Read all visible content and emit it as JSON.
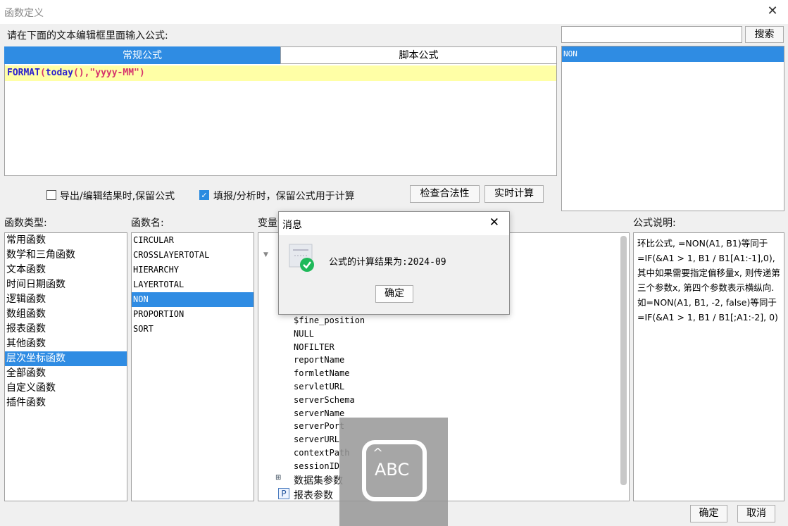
{
  "window": {
    "title": "函数定义"
  },
  "editor_prompt": "请在下面的文本编辑框里面输入公式:",
  "search": {
    "value": "",
    "button_label": "搜索"
  },
  "tabs": [
    {
      "label": "常规公式",
      "active": true
    },
    {
      "label": "脚本公式",
      "active": false
    }
  ],
  "formula": {
    "fn": "FORMAT",
    "p1": "(",
    "arg1": "today",
    "p2": "(),",
    "arg2": "\"yyyy-MM\"",
    "p3": ")"
  },
  "search_results": [
    {
      "label": "NON",
      "selected": true
    }
  ],
  "options": {
    "keep_on_export_label": "导出/编辑结果时,保留公式",
    "keep_on_export_checked": false,
    "keep_on_fill_label": "填报/分析时，保留公式用于计算",
    "keep_on_fill_checked": true
  },
  "buttons": {
    "check_validity": "检查合法性",
    "realtime_calc": "实时计算",
    "ok": "确定",
    "cancel": "取消"
  },
  "function_types": {
    "label": "函数类型:",
    "items": [
      "常用函数",
      "数学和三角函数",
      "文本函数",
      "时间日期函数",
      "逻辑函数",
      "数组函数",
      "报表函数",
      "其他函数",
      "层次坐标函数",
      "全部函数",
      "自定义函数",
      "插件函数"
    ],
    "selected_index": 8
  },
  "function_names": {
    "label": "函数名:",
    "items": [
      "CIRCULAR",
      "CROSSLAYERTOTAL",
      "HIERARCHY",
      "LAYERTOTAL",
      "NON",
      "PROPORTION",
      "SORT"
    ],
    "selected_index": 4
  },
  "variables": {
    "label": "变量",
    "items": [
      "$fine_position",
      "NULL",
      "NOFILTER",
      "reportName",
      "formletName",
      "servletURL",
      "serverSchema",
      "serverName",
      "serverPort",
      "serverURL",
      "contextPath",
      "sessionID"
    ],
    "groups": [
      {
        "label": "数据集参数",
        "icon": "dataset-param-icon"
      },
      {
        "label": "报表参数",
        "icon": "report-param-icon"
      }
    ]
  },
  "description": {
    "label": "公式说明:",
    "text": "环比公式, =NON(A1, B1)等同于=IF(&A1 > 1, B1 / B1[A1:-1],0), 其中如果需要指定偏移量x, 则传递第三个参数x, 第四个参数表示横纵向. 如=NON(A1, B1, -2, false)等同于=IF(&A1 > 1, B1 / B1[;A1:-2], 0)"
  },
  "message_dialog": {
    "title": "消息",
    "text": "公式的计算结果为:2024-09",
    "ok_label": "确定"
  },
  "ime_overlay": {
    "label": "ABC"
  }
}
